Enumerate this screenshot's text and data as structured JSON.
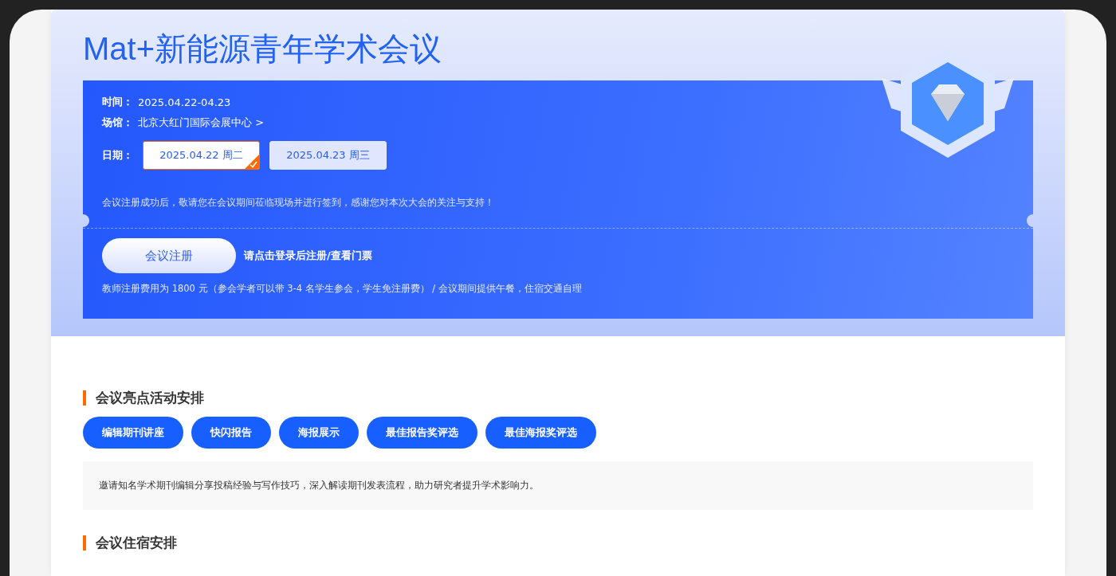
{
  "title": "Mat+新能源青年学术会议",
  "info": [
    {
      "label": "时间：",
      "value": "2025.04.22-04.23"
    },
    {
      "label": "场馆：",
      "value": "北京大红门国际会展中心 >"
    }
  ],
  "date_label": "日期：",
  "dates": [
    {
      "label": "2025.04.22 周二",
      "selected": true
    },
    {
      "label": "2025.04.23 周三",
      "selected": false
    }
  ],
  "notice": "会议注册成功后，敬请您在会议期间莅临现场并进行签到，感谢您对本次大会的关注与支持！",
  "register_button": "会议注册",
  "login_hint": "请点击登录后注册/查看门票",
  "fee_note": "教师注册费用为 1800 元（参会学者可以带 3-4 名学生参会，学生免注册费） / 会议期间提供午餐，住宿交通自理",
  "sections": [
    {
      "heading": "会议亮点活动安排",
      "tags": [
        "编辑期刊讲座",
        "快闪报告",
        "海报展示",
        "最佳报告奖评选",
        "最佳海报奖评选"
      ],
      "description": "邀请知名学术期刊编辑分享投稿经验与写作技巧，深入解读期刊发表流程，助力研究者提升学术影响力。"
    },
    {
      "heading": "会议住宿安排"
    }
  ]
}
